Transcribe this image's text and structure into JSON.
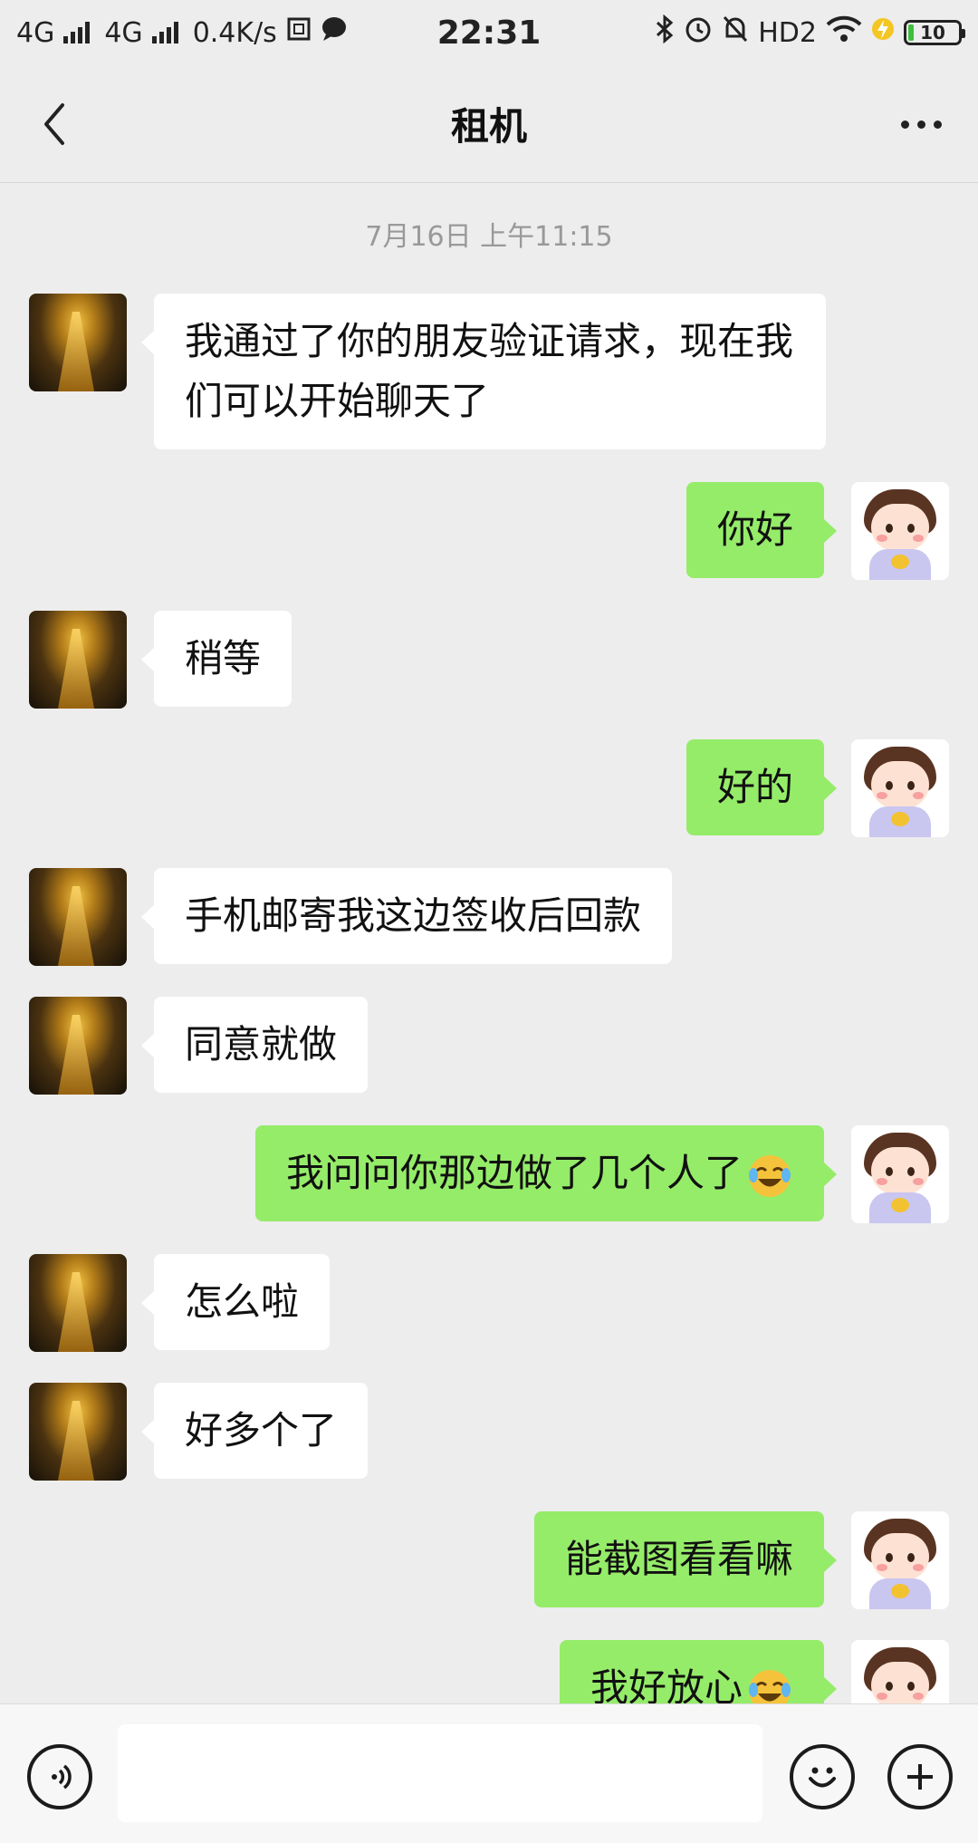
{
  "status_bar": {
    "network1": "4G",
    "network2": "4G",
    "speed": "0.4K/s",
    "time": "22:31",
    "hd": "HD2",
    "battery": "10"
  },
  "header": {
    "title": "租机"
  },
  "chat": {
    "timestamp": "7月16日 上午11:15",
    "messages": [
      {
        "side": "left",
        "text": "我通过了你的朋友验证请求，现在我们可以开始聊天了"
      },
      {
        "side": "right",
        "text": "你好"
      },
      {
        "side": "left",
        "text": "稍等"
      },
      {
        "side": "right",
        "text": "好的"
      },
      {
        "side": "left",
        "text": "手机邮寄我这边签收后回款"
      },
      {
        "side": "left",
        "text": "同意就做"
      },
      {
        "side": "right",
        "text": "我问问你那边做了几个人了",
        "emoji": "laughing-crying-emoji"
      },
      {
        "side": "left",
        "text": "怎么啦"
      },
      {
        "side": "left",
        "text": "好多个了"
      },
      {
        "side": "right",
        "text": "能截图看看嘛"
      },
      {
        "side": "right",
        "text": "我好放心",
        "emoji": "laughing-crying-emoji"
      }
    ]
  },
  "input": {
    "value": "",
    "placeholder": ""
  },
  "colors": {
    "background": "#ededed",
    "sent_bubble": "#95ec69",
    "received_bubble": "#ffffff"
  },
  "icons": {
    "back": "chevron-left-icon",
    "more": "more-dots-icon",
    "voice": "voice-icon",
    "emoji": "emoji-icon",
    "plus": "plus-icon"
  }
}
